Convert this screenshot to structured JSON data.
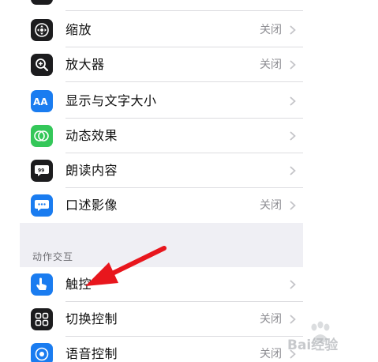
{
  "settings": {
    "top_group": [
      {
        "id": "zoom",
        "icon": "zoom-icon",
        "label": "缩放",
        "value": "关闭",
        "icon_bg": "#1c1c1e"
      },
      {
        "id": "magnifier",
        "icon": "magnifier-icon",
        "label": "放大器",
        "value": "关闭",
        "icon_bg": "#1c1c1e"
      },
      {
        "id": "display-text-size",
        "icon": "text-size-icon",
        "label": "显示与文字大小",
        "value": "",
        "icon_bg": "#1a7cf0"
      },
      {
        "id": "motion",
        "icon": "motion-icon",
        "label": "动态效果",
        "value": "",
        "icon_bg": "#34c759"
      },
      {
        "id": "spoken-content",
        "icon": "spoken-content-icon",
        "label": "朗读内容",
        "value": "",
        "icon_bg": "#1c1c1e"
      },
      {
        "id": "audio-descriptions",
        "icon": "audio-description-icon",
        "label": "口述影像",
        "value": "关闭",
        "icon_bg": "#1a7cf0"
      }
    ],
    "section_header": "动作交互",
    "bottom_group": [
      {
        "id": "touch",
        "icon": "touch-hand-icon",
        "label": "触控",
        "value": "",
        "icon_bg": "#1a7cf0"
      },
      {
        "id": "switch-control",
        "icon": "switch-control-icon",
        "label": "切换控制",
        "value": "关闭",
        "icon_bg": "#1c1c1e"
      },
      {
        "id": "voice-control",
        "icon": "voice-control-icon",
        "label": "语音控制",
        "value": "关闭",
        "icon_bg": "#1a7cf0"
      }
    ]
  },
  "annotation": {
    "arrow_color": "#e8161d"
  },
  "watermark": {
    "icon": "baidu-paw-icon",
    "text": "Bai经验"
  }
}
